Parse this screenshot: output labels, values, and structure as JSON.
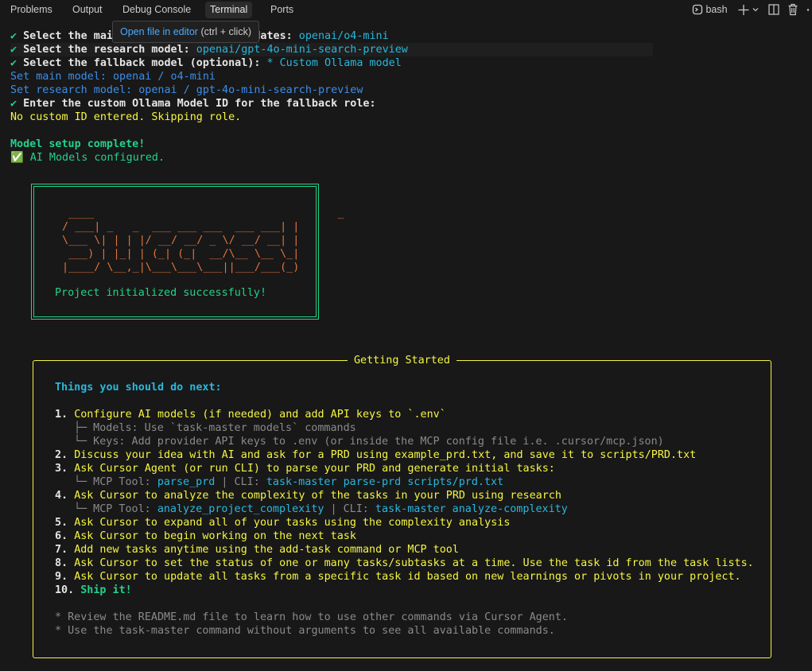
{
  "tabs": [
    "Problems",
    "Output",
    "Debug Console",
    "Terminal",
    "Ports"
  ],
  "active_tab": "Terminal",
  "terminal_name": "bash",
  "tooltip": {
    "link": "Open file in editor",
    "hint": " (ctrl + click)"
  },
  "lines": {
    "l1_label": "Select the main model for primary updates: ",
    "l1_value": "openai/o4-mini",
    "l2_label": "Select the research model: ",
    "l2_value": "openai/gpt-4o-mini-search-preview",
    "l3_label": "Select the fallback model (optional): ",
    "l3_value": "* Custom Ollama model",
    "l4": "Set main model: openai / o4-mini",
    "l5": "Set research model: openai / gpt-4o-mini-search-preview",
    "l6": "Enter the custom Ollama Model ID for the fallback role:",
    "l7": "No custom ID entered. Skipping role.",
    "l8": "Model setup complete!",
    "l9": "✅ AI Models configured."
  },
  "success_box": {
    "ascii": " ____                                      _ \n/ ___| _   _  ___ ___ ___  ___ ___| |\n\\___ \\| | | |/ __/ __/ _ \\/ __/ __| |\n ___) | |_| | (_| (_|  __/\\__ \\__ \\_|\n|____/ \\__,_|\\___\\___\\___||___/___(_)",
    "message": "Project initialized successfully!"
  },
  "getting_started": {
    "title": "Getting Started",
    "heading": "Things you should do next:",
    "s1": "Configure AI models (if needed) and add API keys to `.env`",
    "s1a": "├─ Models: Use `task-master models` commands",
    "s1b": "└─ Keys: Add provider API keys to .env (or inside the MCP config file i.e. .cursor/mcp.json)",
    "s2": "Discuss your idea with AI and ask for a PRD using example_prd.txt, and save it to scripts/PRD.txt",
    "s3": "Ask Cursor Agent (or run CLI) to parse your PRD and generate initial tasks:",
    "s3_prefix": "└─ MCP Tool: ",
    "s3_tool": "parse_prd",
    "s3_mid": " | CLI: ",
    "s3_cli": "task-master parse-prd scripts/prd.txt",
    "s4": "Ask Cursor to analyze the complexity of the tasks in your PRD using research",
    "s4_prefix": "└─ MCP Tool: ",
    "s4_tool": "analyze_project_complexity",
    "s4_mid": " | CLI: ",
    "s4_cli": "task-master analyze-complexity",
    "s5": "Ask Cursor to expand all of your tasks using the complexity analysis",
    "s6": "Ask Cursor to begin working on the next task",
    "s7": "Add new tasks anytime using the add-task command or MCP tool",
    "s8": "Ask Cursor to set the status of one or many tasks/subtasks at a time. Use the task id from the task lists.",
    "s9": "Ask Cursor to update all tasks from a specific task id based on new learnings or pivots in your project.",
    "s10": "Ship it!",
    "n1": "1.",
    "n2": "2.",
    "n3": "3.",
    "n4": "4.",
    "n5": "5.",
    "n6": "6.",
    "n7": "7.",
    "n8": "8.",
    "n9": "9.",
    "n10": "10.",
    "note1": "* Review the README.md file to learn how to use other commands via Cursor Agent.",
    "note2": "* Use the task-master command without arguments to see all available commands."
  }
}
